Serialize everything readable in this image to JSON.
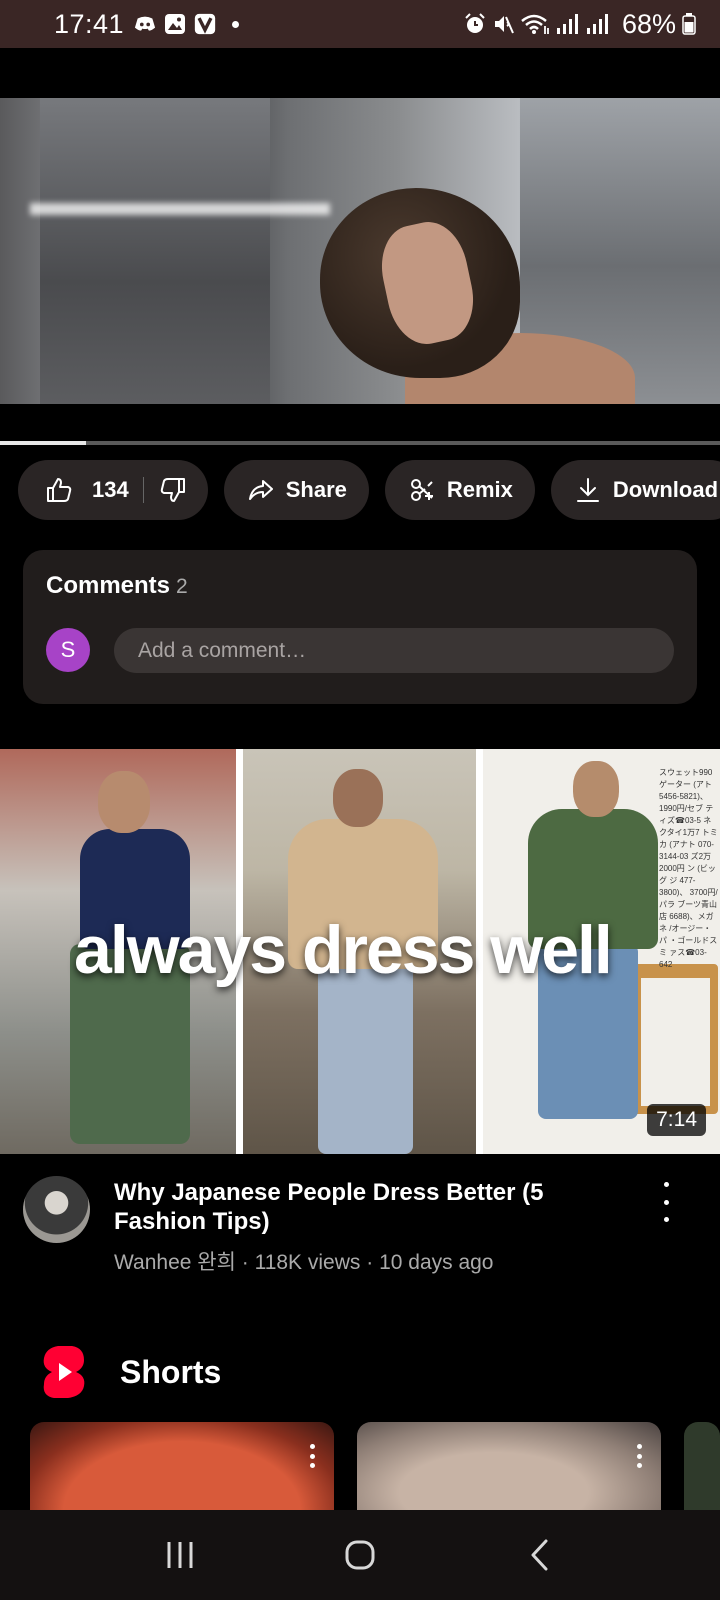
{
  "status_bar": {
    "time": "17:41",
    "battery_percent": "68%",
    "left_icons": [
      "discord-icon",
      "gallery-icon",
      "v-app-icon",
      "dot-icon"
    ],
    "right_icons": [
      "alarm-icon",
      "mute-icon",
      "wifi-icon",
      "signal-icon",
      "signal-icon",
      "battery-icon"
    ]
  },
  "player": {
    "progress_fraction": 0.12
  },
  "actions": {
    "like_count": "134",
    "share_label": "Share",
    "remix_label": "Remix",
    "download_label": "Download"
  },
  "comments": {
    "title": "Comments",
    "count": "2",
    "avatar_letter": "S",
    "avatar_color": "#a743c7",
    "placeholder": "Add a comment…"
  },
  "recommended": {
    "thumbnail_text": "always dress well",
    "duration": "7:14",
    "title": "Why Japanese People Dress Better (5 Fashion Tips)",
    "meta": "Wanhee 완희 · 118K views · 10 days ago",
    "mag_text": "スウェット990 ゲーター (アト 5456-5821)、 1990円/セブ ティズ☎03-5 ネクタイ1万7 トミカ (アナト 070-3144-03 ズ2万2000円 ン (ビッグ ジ 477-3800)、 3700円/パラ ブーツ青山店 6688)、メガネ /オージー・パ ・ゴールドスミ ァス☎03-642"
  },
  "shorts": {
    "title": "Shorts",
    "brand_color": "#ff0033"
  },
  "nav": {
    "buttons": [
      "recents-icon",
      "home-icon",
      "back-icon"
    ]
  }
}
